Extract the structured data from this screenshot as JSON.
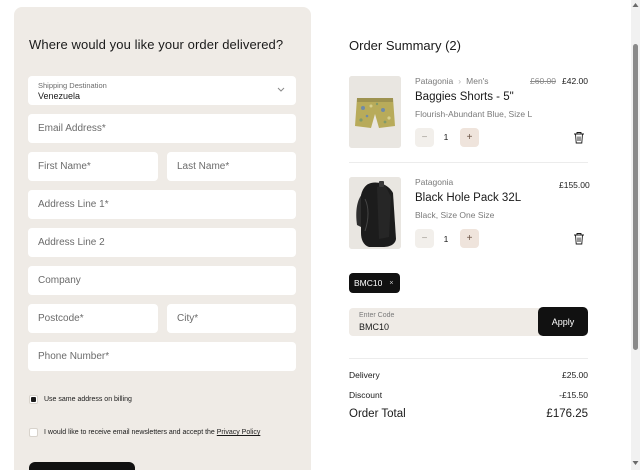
{
  "delivery": {
    "title": "Where would you like your order delivered?",
    "shipping_label": "Shipping Destination",
    "shipping_value": "Venezuela",
    "email_placeholder": "Email Address*",
    "first_name_placeholder": "First Name*",
    "last_name_placeholder": "Last Name*",
    "address1_placeholder": "Address Line 1*",
    "address2_placeholder": "Address Line 2",
    "company_placeholder": "Company",
    "postcode_placeholder": "Postcode*",
    "city_placeholder": "City*",
    "phone_placeholder": "Phone Number*",
    "same_billing_label": "Use same address on billing",
    "same_billing_checked": true,
    "newsletter_label": "I would like to receive email newsletters and accept the ",
    "newsletter_link": "Privacy Policy",
    "newsletter_checked": false
  },
  "summary": {
    "title": "Order Summary (2)",
    "items": [
      {
        "brand": "Patagonia",
        "category": "Men's",
        "price_old": "£60.00",
        "price": "£42.00",
        "name": "Baggies Shorts - 5\"",
        "variant": "Flourish-Abundant Blue, Size L",
        "qty": "1",
        "minus": "−",
        "plus": "+"
      },
      {
        "brand": "Patagonia",
        "price": "£155.00",
        "name": "Black Hole Pack 32L",
        "variant": "Black, Size One Size",
        "qty": "1",
        "minus": "−",
        "plus": "+"
      }
    ],
    "promo_chip": "BMC10",
    "promo_remove": "×",
    "code_label": "Enter Code",
    "code_value": "BMC10",
    "apply_label": "Apply",
    "delivery_label": "Delivery",
    "delivery_value": "£25.00",
    "discount_label": "Discount",
    "discount_value": "-£15.50",
    "total_label": "Order Total",
    "total_value": "£176.25"
  },
  "colors": {
    "panel_bg": "#efebe6",
    "accent_dark": "#111111"
  }
}
